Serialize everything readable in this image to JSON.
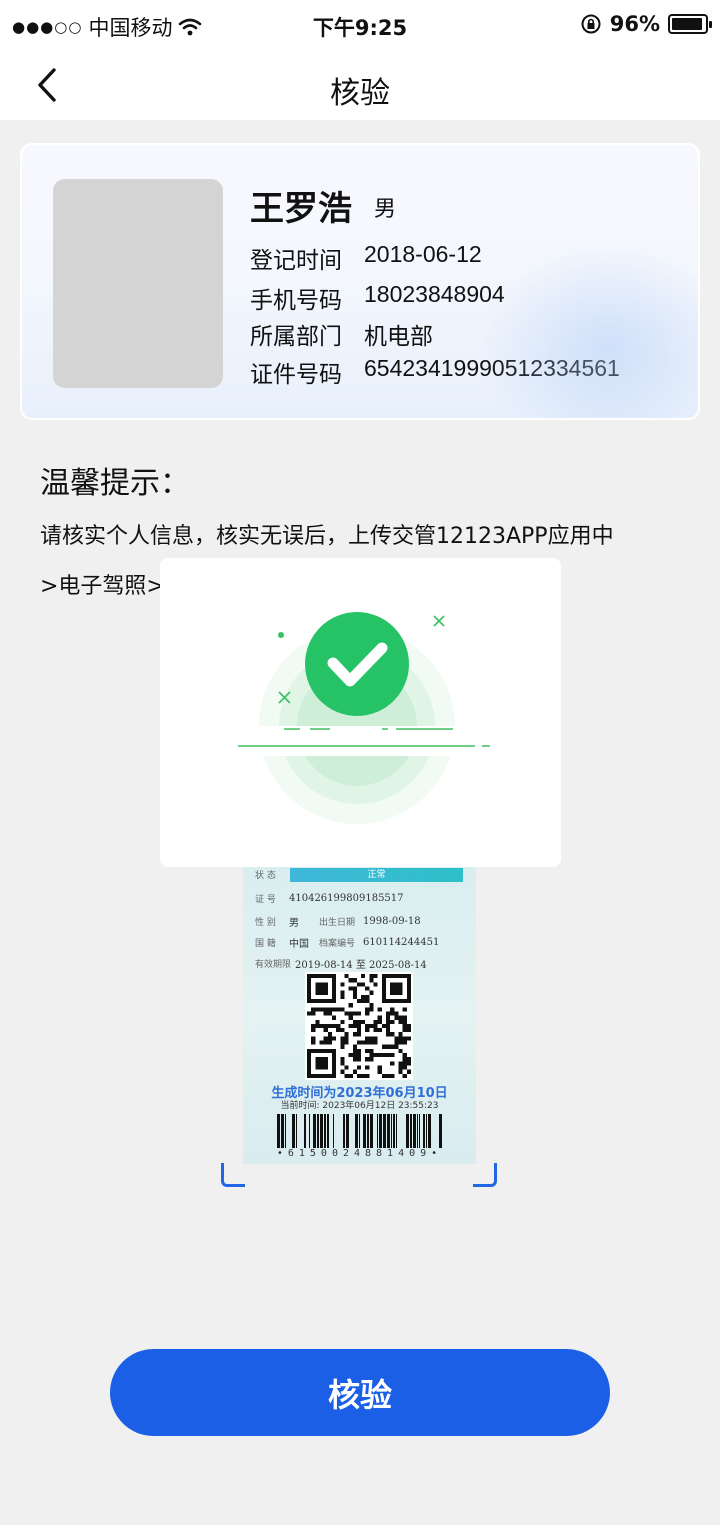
{
  "status_bar": {
    "signal": "●●●○○",
    "carrier": "中国移动",
    "time": "下午9:25",
    "battery": "96%"
  },
  "nav": {
    "title": "核验"
  },
  "profile": {
    "name": "王罗浩",
    "gender": "男",
    "fields": [
      {
        "label": "登记时间",
        "value": "2018-06-12"
      },
      {
        "label": "手机号码",
        "value": "18023848904"
      },
      {
        "label": "所属部门",
        "value": "机电部"
      },
      {
        "label": "证件号码",
        "value": "654234199905123345​61"
      }
    ]
  },
  "tips": {
    "title": "温馨提示：",
    "line1": "请核实个人信息，核实无误后，上传交管12123APP应用中",
    "line2": ">电子驾照>"
  },
  "license": {
    "status_label": "状 态",
    "status_value": "正常",
    "id_label": "证 号",
    "id_value": "410426199809185517",
    "gender_label": "性 别",
    "gender_value": "男",
    "birth_label": "出生日期",
    "birth_value": "1998-09-18",
    "nation_label": "国 籍",
    "nation_value": "中国",
    "file_label": "档案编号",
    "file_value": "610114244451",
    "valid_label": "有效期限",
    "valid_value": "2019-08-14 至 2025-08-14",
    "generated": "生成时间为2023年06月10日",
    "current": "当前时间: 2023年06月12日 23:55:23",
    "barcode_number": "•615002488140​9•"
  },
  "button": {
    "label": "核验"
  },
  "colors": {
    "primary": "#1a5fe6",
    "success": "#26c266"
  }
}
